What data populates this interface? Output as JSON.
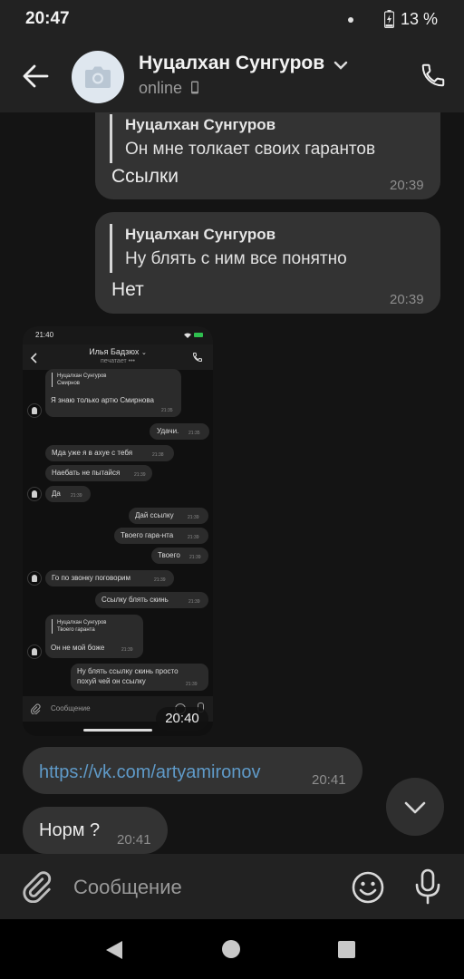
{
  "status_bar": {
    "time": "20:47",
    "battery": "13 %"
  },
  "header": {
    "name": "Нуцалхан Сунгуров",
    "status": "online",
    "icons": [
      "back-arrow-icon",
      "camera-icon",
      "chevron-down-icon",
      "mobile-icon",
      "phone-icon"
    ]
  },
  "messages": [
    {
      "quote_author": "Нуцалхан Сунгуров",
      "quote_text": "Он мне толкает своих гарантов",
      "text": "Ссылки",
      "time": "20:39"
    },
    {
      "quote_author": "Нуцалхан Сунгуров",
      "quote_text": "Ну блять с ним все понятно",
      "text": "Нет",
      "time": "20:39"
    }
  ],
  "screenshot": {
    "time_badge": "20:40",
    "inner": {
      "status_time": "21:40",
      "contact_name": "Илья Бадзюх",
      "contact_status": "печатает",
      "input_placeholder": "Сообщение",
      "bubbles": [
        {
          "quote_author": "Нуцалхан Сунгуров",
          "quote_text": "Смирнов",
          "text": "Я знаю только артю Смирнова",
          "time": "21:35"
        },
        {
          "text": "Удачи.",
          "time": "21:35"
        },
        {
          "text": "Мда уже я в ахуе с тебя",
          "time": "21:38"
        },
        {
          "text": "Наебать не пытайся",
          "time": "21:39"
        },
        {
          "text": "Да",
          "time": "21:39"
        },
        {
          "text": "Дай ссылку",
          "time": "21:39"
        },
        {
          "text": "Твоего гара-нта",
          "time": "21:39"
        },
        {
          "text": "Твоего",
          "time": "21:39"
        },
        {
          "text": "Го по звонку поговорим",
          "time": "21:39"
        },
        {
          "text": "Ссылку блять скинь",
          "time": "21:39"
        },
        {
          "quote_author": "Нуцалхан Сунгуров",
          "quote_text": "Твоего гаранта",
          "text": "Он не мой боже",
          "time": "21:39"
        },
        {
          "text_line1": "Ну блять ссылку скинь просто",
          "text_line2": "похуй чей он ссылку",
          "time": "21:39"
        }
      ]
    }
  },
  "link_message": {
    "text": "https://vk.com/artyamironov",
    "time": "20:41"
  },
  "last_message": {
    "text": "Норм ?",
    "time": "20:41"
  },
  "input": {
    "placeholder": "Сообщение",
    "icons": [
      "paperclip-icon",
      "emoji-icon",
      "microphone-icon"
    ]
  },
  "nav": {
    "icons": [
      "nav-back-icon",
      "nav-home-icon",
      "nav-recents-icon"
    ]
  }
}
